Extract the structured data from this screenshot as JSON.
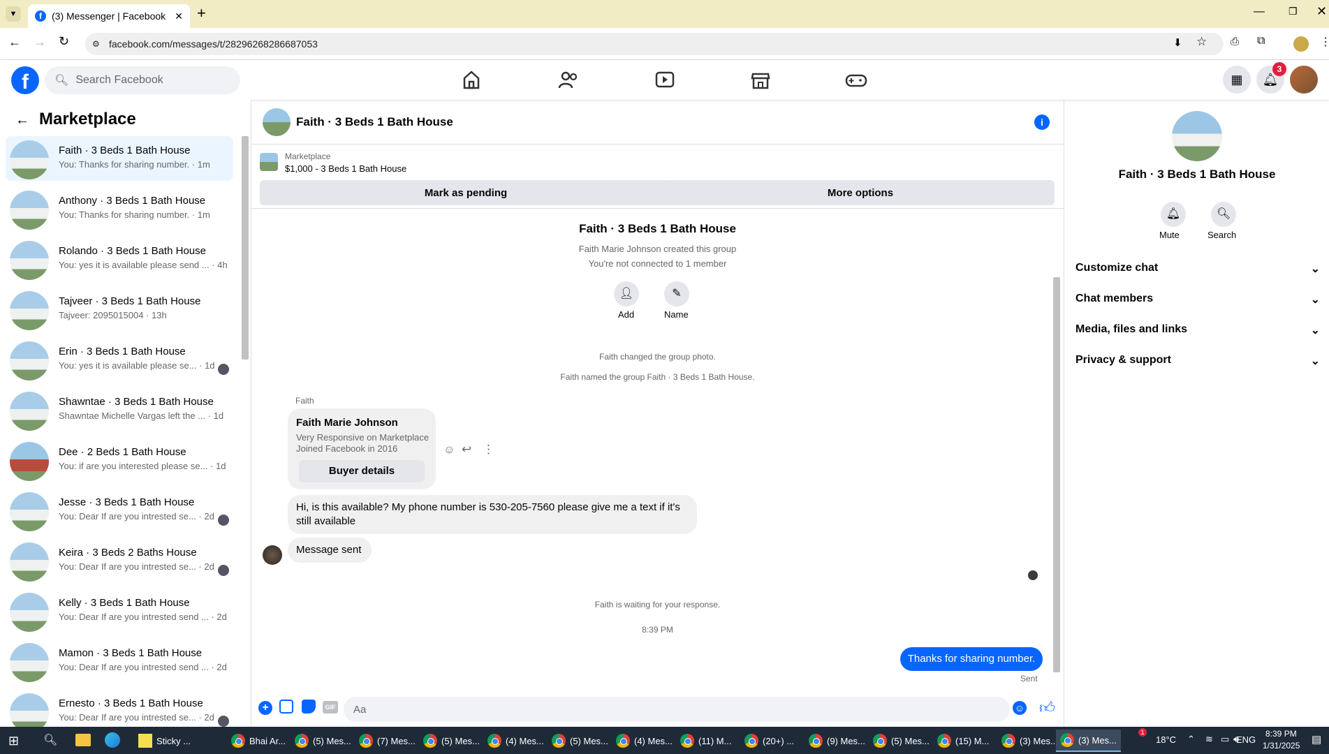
{
  "browser": {
    "tab_title": "(3) Messenger | Facebook",
    "url": "facebook.com/messages/t/28296268286687053"
  },
  "fb": {
    "search_placeholder": "Search Facebook",
    "notification_count": "3"
  },
  "left": {
    "title": "Marketplace",
    "conversations": [
      {
        "name": "Faith · 3 Beds 1 Bath House",
        "preview": "You: Thanks for sharing number. · 1m",
        "active": true
      },
      {
        "name": "Anthony · 3 Beds 1 Bath House",
        "preview": "You: Thanks for sharing number. · 1m"
      },
      {
        "name": "Rolando · 3 Beds 1 Bath House",
        "preview": "You: yes it is available please send ... · 4h"
      },
      {
        "name": "Tajveer · 3 Beds 1 Bath House",
        "preview": "Tajveer: 2095015004 · 13h"
      },
      {
        "name": "Erin · 3 Beds 1 Bath House",
        "preview": "You: yes it is available please se... · 1d"
      },
      {
        "name": "Shawntae · 3 Beds 1 Bath House",
        "preview": "Shawntae Michelle Vargas left the ... · 1d"
      },
      {
        "name": "Dee · 2 Beds 1 Bath House",
        "preview": "You: if are you interested please se... · 1d"
      },
      {
        "name": "Jesse · 3 Beds 1 Bath House",
        "preview": "You: Dear If are you intrested se... · 2d"
      },
      {
        "name": "Keira · 3 Beds 2 Baths House",
        "preview": "You: Dear If are you intrested se... · 2d"
      },
      {
        "name": "Kelly · 3 Beds 1 Bath House",
        "preview": "You: Dear If are you intrested send ... · 2d"
      },
      {
        "name": "Mamon · 3 Beds 1 Bath House",
        "preview": "You: Dear If are you intrested send ... · 2d"
      },
      {
        "name": "Ernesto · 3 Beds 1 Bath House",
        "preview": "You: Dear If are you intrested se... · 2d"
      }
    ]
  },
  "chat": {
    "title": "Faith · 3 Beds 1 Bath House",
    "listing_source": "Marketplace",
    "listing": "$1,000 - 3 Beds 1 Bath House",
    "mark_pending": "Mark as pending",
    "more_options": "More options",
    "group_name": "Faith · 3 Beds 1 Bath House",
    "created_by": "Faith Marie Johnson created this group",
    "not_connected": "You're not connected to 1 member",
    "add_label": "Add",
    "name_label": "Name",
    "event1": "Faith changed the group photo.",
    "event2": "Faith named the group Faith · 3 Beds 1 Bath House.",
    "sender": "Faith",
    "card_name": "Faith Marie Johnson",
    "card_line1": "Very Responsive on Marketplace",
    "card_line2": "Joined Facebook in 2016",
    "buyer_details": "Buyer details",
    "msg1": "Hi, is this available? My phone number is 530-205-7560 please give me a text if it's still available",
    "msg2": "Message sent",
    "waiting": "Faith is waiting for your response.",
    "time": "8:39 PM",
    "my_msg": "Thanks for sharing number.",
    "sent": "Sent",
    "input_placeholder": "Aa",
    "gif": "GIF"
  },
  "right": {
    "name": "Faith · 3 Beds 1 Bath House",
    "mute": "Mute",
    "search": "Search",
    "sections": [
      "Customize chat",
      "Chat members",
      "Media, files and links",
      "Privacy & support"
    ]
  },
  "taskbar": {
    "items": [
      "Sticky ...",
      "Bhai Ar...",
      "(5) Mes...",
      "(7) Mes...",
      "(5) Mes...",
      "(4) Mes...",
      "(5) Mes...",
      "(4) Mes...",
      "(11) M...",
      "(20+) ...",
      "(9) Mes...",
      "(5) Mes...",
      "(15) M...",
      "(3) Mes...",
      "(3) Mes..."
    ],
    "weather": "18°C",
    "lang": "ENG",
    "clock_time": "8:39 PM",
    "clock_date": "1/31/2025",
    "weather_badge": "1"
  },
  "colors": {
    "fb_blue": "#0866ff",
    "active_bg": "#ebf5ff",
    "notif_red": "#e41e3f"
  }
}
